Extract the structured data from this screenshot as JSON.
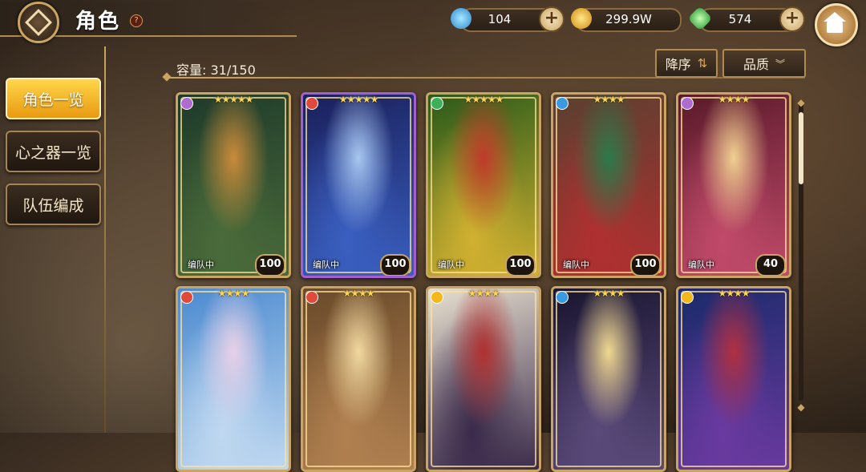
{
  "header": {
    "title": "角色",
    "help": "?"
  },
  "currencies": [
    {
      "name": "water-drop",
      "value": "104",
      "color": "#4cc3f0"
    },
    {
      "name": "gold-coin",
      "value": "299.9W",
      "color": "#f2b81c"
    },
    {
      "name": "green-crystal",
      "value": "574",
      "color": "#5fd86a"
    }
  ],
  "sidebar": {
    "items": [
      {
        "label": "角色一览",
        "active": true
      },
      {
        "label": "心之器一览",
        "active": false
      },
      {
        "label": "队伍编成",
        "active": false
      }
    ]
  },
  "capacity": "容量: 31/150",
  "sort": {
    "order_label": "降序",
    "order_icon": "⇅",
    "filter_label": "品质",
    "filter_icon": "︾"
  },
  "cards": [
    {
      "stars": "★★★★★",
      "team": "编队中",
      "level": "100",
      "attr_color": "#b06bd0",
      "art": [
        "#1e3a2a",
        "#4a6b3a",
        "#c98a3a"
      ]
    },
    {
      "stars": "★★★★★",
      "team": "编队中",
      "level": "100",
      "attr_color": "#e04a3a",
      "art": [
        "#1a1f5a",
        "#3a5fc0",
        "#a7c6f0"
      ]
    },
    {
      "stars": "★★★★★",
      "team": "编队中",
      "level": "100",
      "attr_color": "#3ab05a",
      "art": [
        "#2a5a1a",
        "#d0b030",
        "#c03a2a"
      ]
    },
    {
      "stars": "★★★★",
      "team": "编队中",
      "level": "100",
      "attr_color": "#3a9ae0",
      "art": [
        "#5a4030",
        "#b03030",
        "#2a7a4a"
      ]
    },
    {
      "stars": "★★★★",
      "team": "编队中",
      "level": "40",
      "attr_color": "#b06bd0",
      "art": [
        "#5a1a2a",
        "#c04a6a",
        "#f0d090"
      ]
    },
    {
      "stars": "★★★★",
      "team": "",
      "level": "",
      "attr_color": "#e04a3a",
      "art": [
        "#4a8ad0",
        "#c0d8f0",
        "#e8d0e8"
      ]
    },
    {
      "stars": "★★★★",
      "team": "",
      "level": "",
      "attr_color": "#e04a3a",
      "art": [
        "#6a4a2a",
        "#b08050",
        "#f0d8a0"
      ]
    },
    {
      "stars": "★★★★",
      "team": "",
      "level": "",
      "attr_color": "#f2b81c",
      "art": [
        "#e8e0d0",
        "#3a2a4a",
        "#b03030"
      ]
    },
    {
      "stars": "★★★★",
      "team": "",
      "level": "",
      "attr_color": "#3a9ae0",
      "art": [
        "#1a1530",
        "#5a4a7a",
        "#f0d890"
      ]
    },
    {
      "stars": "★★★★",
      "team": "",
      "level": "",
      "attr_color": "#f2b81c",
      "art": [
        "#1a2a6a",
        "#6a3aa0",
        "#b03040"
      ]
    }
  ]
}
